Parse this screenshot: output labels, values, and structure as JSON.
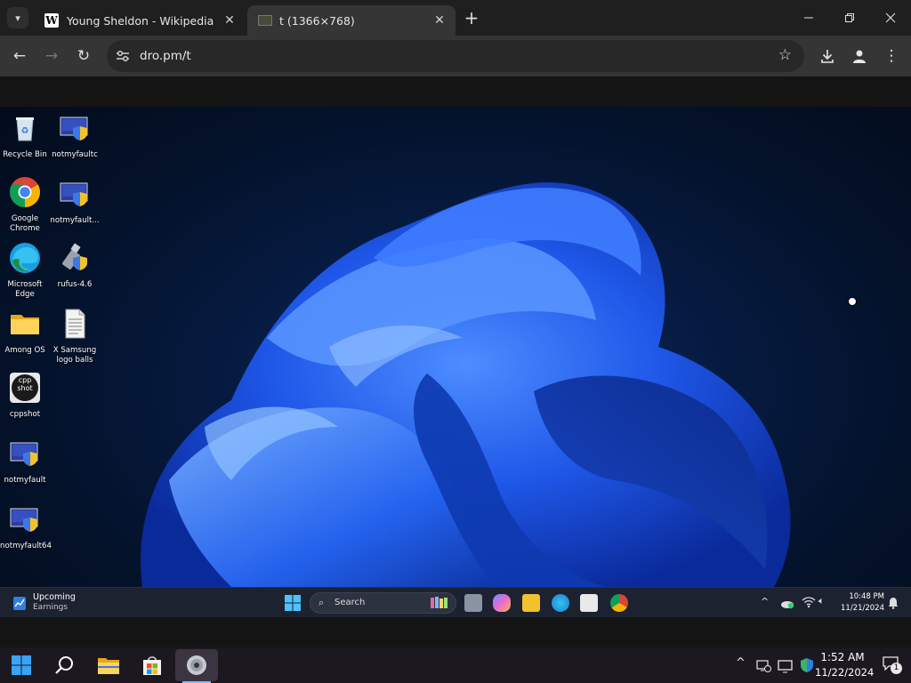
{
  "browser": {
    "tabs": [
      {
        "title": "Young Sheldon - Wikipedia",
        "favicon": "wikipedia-icon",
        "active": false
      },
      {
        "title": "t (1366×768)",
        "favicon": "image-icon",
        "active": true
      }
    ],
    "url": "dro.pm/t"
  },
  "desktop": {
    "icons": [
      {
        "label": "Recycle Bin",
        "icon": "recycle-bin-icon"
      },
      {
        "label": "notmyfaultc",
        "icon": "app-shield-icon"
      },
      {
        "label": "Google Chrome",
        "icon": "chrome-icon"
      },
      {
        "label": "notmyfault...",
        "icon": "app-shield-icon"
      },
      {
        "label": "Microsoft Edge",
        "icon": "edge-icon"
      },
      {
        "label": "rufus-4.6",
        "icon": "usb-shield-icon"
      },
      {
        "label": "Among OS",
        "icon": "folder-icon"
      },
      {
        "label": "X Samsung logo balls",
        "icon": "text-file-icon"
      },
      {
        "label": "cppshot",
        "icon": "cppshot-icon"
      },
      {
        "label": "notmyfault",
        "icon": "app-shield-icon"
      },
      {
        "label": "notmyfault64",
        "icon": "app-shield-icon"
      }
    ],
    "cppshot_logo_text": "cpp shot"
  },
  "inner_taskbar": {
    "widget_title": "Upcoming",
    "widget_subtitle": "Earnings",
    "search_placeholder": "Search",
    "time": "10:48 PM",
    "date": "11/21/2024"
  },
  "host_taskbar": {
    "time": "1:52 AM",
    "date": "11/22/2024",
    "notification_count": "1"
  },
  "colors": {
    "tab_bar": "#1f1f1f",
    "toolbar": "#353535",
    "bloom_blue": "#1f57e8",
    "taskbar": "#1c2230"
  }
}
